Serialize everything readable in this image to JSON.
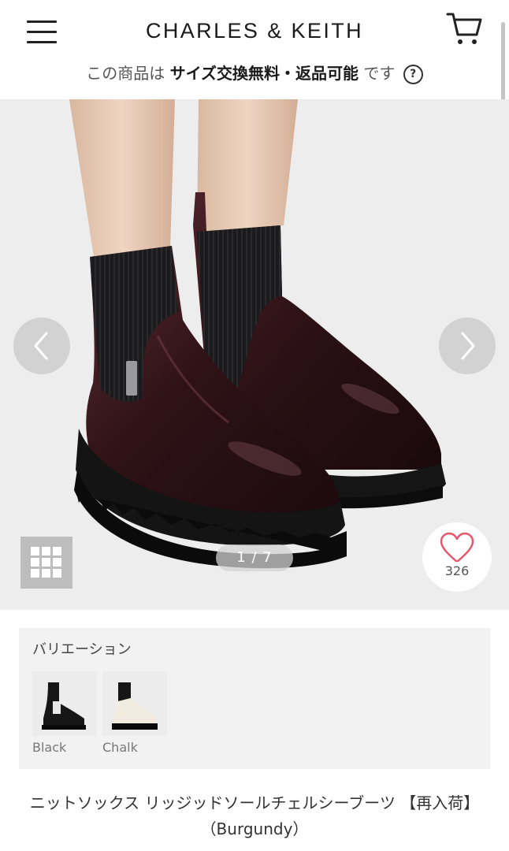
{
  "header": {
    "brand": "CHARLES & KEITH"
  },
  "notice": {
    "prefix": "この商品は",
    "highlight": "サイズ交換無料・返品可能",
    "suffix": "です",
    "help_symbol": "?"
  },
  "gallery": {
    "counter": "1 / 7",
    "likes": "326"
  },
  "variations": {
    "title": "バリエーション",
    "items": [
      {
        "label": "Black"
      },
      {
        "label": "Chalk"
      }
    ]
  },
  "product": {
    "title": "ニットソックス リッジッドソールチェルシーブーツ 【再入荷】（Burgundy）"
  },
  "colors": {
    "burgundy": "#3a1a1e",
    "heart": "#e8576b",
    "panel": "#f2f2f2"
  }
}
